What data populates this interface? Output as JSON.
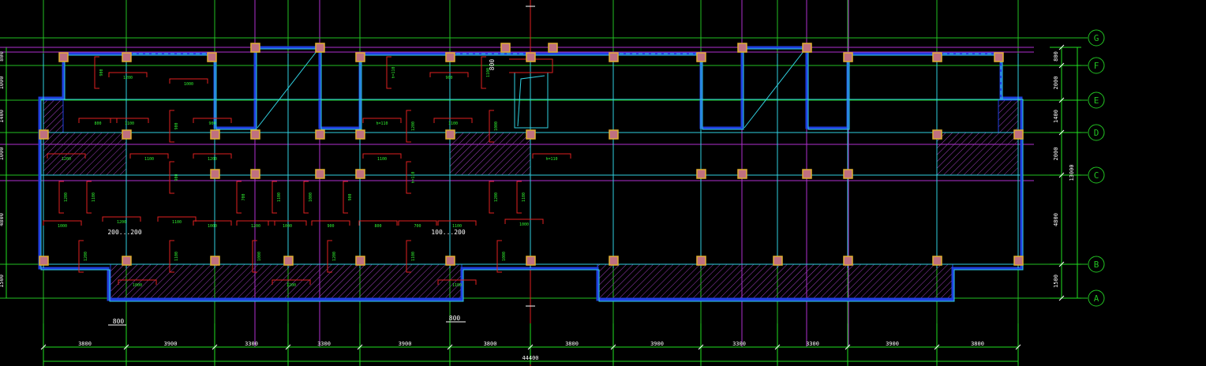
{
  "colors": {
    "background": "#000000",
    "grid_green": "#22c022",
    "grid_magenta": "#b030d0",
    "beam_cyan": "#30d0e0",
    "wall_blue": "#2040e0",
    "dim_green": "#20e020",
    "rebar_red": "#e02020",
    "column_fill": "#c07080",
    "column_edge": "#e0b030",
    "hatch": "#a040c0",
    "text_white": "#ffffff",
    "text_green": "#30f030"
  },
  "axis_bubbles": [
    {
      "label": "G"
    },
    {
      "label": "F"
    },
    {
      "label": "E"
    },
    {
      "label": "D"
    },
    {
      "label": "C"
    },
    {
      "label": "B"
    },
    {
      "label": "A"
    }
  ],
  "bottom_dims": [
    "3800",
    "3900",
    "3300",
    "3300",
    "3900",
    "3800",
    "3800",
    "3900",
    "3300",
    "3300",
    "3900",
    "3800"
  ],
  "overall_dim": "44400",
  "right_dims": [
    "800",
    "2000",
    "1400",
    "2000",
    "4800",
    "1500"
  ],
  "right_total": "13000",
  "left_dims": [
    "800",
    "1000",
    "1400",
    "1000",
    "4800",
    "1500"
  ],
  "notes": {
    "offset_left": "800",
    "offset_mid": "800",
    "offset_top": "800",
    "slab_left": "200...200",
    "slab_mid": "100...200"
  },
  "rebar_labels": [
    "1000",
    "1200",
    "1000",
    "900",
    "800",
    "700",
    "1100",
    "1000",
    "900",
    "1300",
    "h=110",
    "1200",
    "1100",
    "1000",
    "1200",
    "1100"
  ]
}
